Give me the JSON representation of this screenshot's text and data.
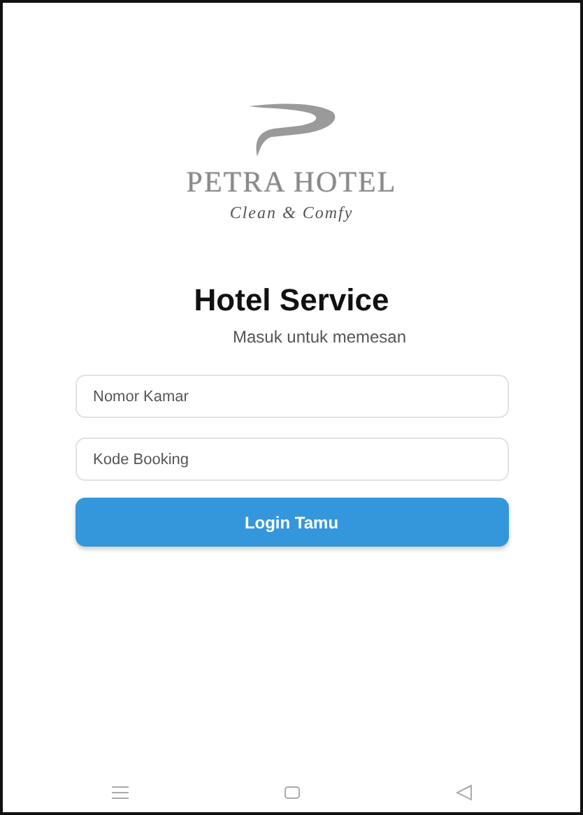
{
  "brand": {
    "name": "PETRA HOTEL",
    "tagline": "Clean & Comfy"
  },
  "title": "Hotel Service",
  "subtitle": "Masuk untuk memesan",
  "fields": [
    {
      "placeholder": "Nomor Kamar"
    },
    {
      "placeholder": "Kode Booking"
    }
  ],
  "button": "Login Tamu"
}
